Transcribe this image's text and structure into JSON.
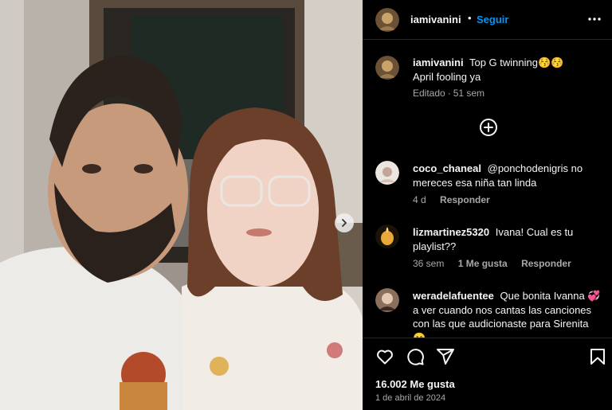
{
  "post": {
    "username": "iamivanini",
    "separator": "•",
    "follow_label": "Seguir",
    "more_icon": "more-options-icon",
    "caption_text": "Top G twinning😚😚 April fooling ya",
    "caption_meta_edited": "Editado",
    "caption_meta_time": "51 sem",
    "meta_separator": "·",
    "load_more_icon": "plus-circle-icon",
    "likes": "16.002 Me gusta",
    "date": "1 de abril de 2024"
  },
  "comments": [
    {
      "username": "coco_chaneal",
      "text": "@ponchodenigris no mereces esa niña tan linda",
      "time": "4 d",
      "likes": "",
      "reply_label": "Responder"
    },
    {
      "username": "lizmartinez5320",
      "text": "Ivana! Cual es tu playlist??",
      "time": "36 sem",
      "likes": "1 Me gusta",
      "reply_label": "Responder"
    },
    {
      "username": "weradelafuentee",
      "text": "Que bonita Ivanna 💞 a ver cuando nos cantas las canciones con las que audicionaste para Sirenita 😊",
      "time": "",
      "likes": "",
      "reply_label": ""
    }
  ],
  "actions": {
    "like_icon": "heart-icon",
    "comment_icon": "comment-icon",
    "share_icon": "share-icon",
    "save_icon": "bookmark-icon"
  },
  "colors": {
    "background": "#000000",
    "text": "#f5f5f5",
    "muted": "#a8a8a8",
    "link": "#0095f6",
    "divider": "#262626"
  }
}
